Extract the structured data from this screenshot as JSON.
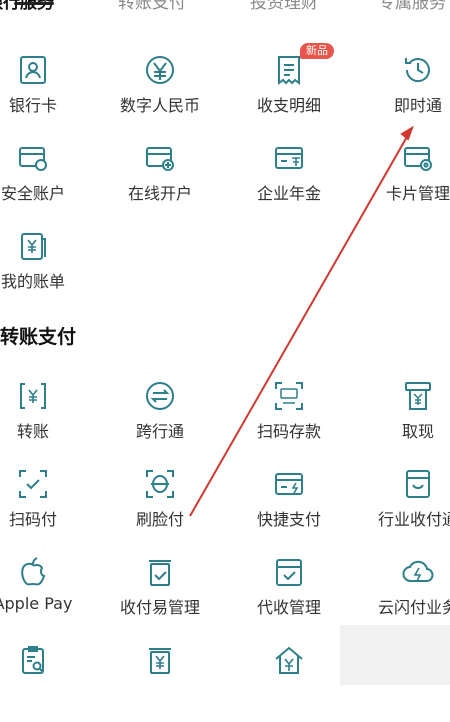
{
  "tabs": [
    {
      "label": "银行服务",
      "active": true
    },
    {
      "label": "转账支付",
      "active": false
    },
    {
      "label": "投资理财",
      "active": false
    },
    {
      "label": "专属服务",
      "active": false
    }
  ],
  "new_badge": "新品",
  "section_title": "转账支付",
  "items": [
    {
      "label": "银行卡",
      "icon": "id-card-icon"
    },
    {
      "label": "数字人民币",
      "icon": "yuan-circle-icon"
    },
    {
      "label": "收支明细",
      "icon": "receipt-icon"
    },
    {
      "label": "即时通",
      "icon": "clock-refresh-icon"
    },
    {
      "label": "安全账户",
      "icon": "card-shield-icon"
    },
    {
      "label": "在线开户",
      "icon": "card-add-icon"
    },
    {
      "label": "企业年金",
      "icon": "card-year-icon"
    },
    {
      "label": "卡片管理",
      "icon": "card-gear-icon"
    },
    {
      "label": "我的账单",
      "icon": "bill-icon"
    },
    {
      "label": "转账",
      "icon": "transfer-yuan-icon"
    },
    {
      "label": "跨行通",
      "icon": "exchange-circle-icon"
    },
    {
      "label": "扫码存款",
      "icon": "atm-scan-icon"
    },
    {
      "label": "取现",
      "icon": "atm-withdraw-icon"
    },
    {
      "label": "扫码付",
      "icon": "scan-check-icon"
    },
    {
      "label": "刷脸付",
      "icon": "face-scan-icon"
    },
    {
      "label": "快捷支付",
      "icon": "card-lightning-icon"
    },
    {
      "label": "行业收付通",
      "icon": "smile-box-icon"
    },
    {
      "label": "Apple Pay",
      "icon": "apple-icon"
    },
    {
      "label": "收付易管理",
      "icon": "clipboard-check-icon"
    },
    {
      "label": "代收管理",
      "icon": "box-check-icon"
    },
    {
      "label": "云闪付业务",
      "icon": "cloud-lightning-icon"
    },
    {
      "label": "",
      "icon": "clipboard-search-icon"
    },
    {
      "label": "",
      "icon": "yuan-document-icon"
    },
    {
      "label": "",
      "icon": "house-yuan-icon"
    }
  ],
  "colors": {
    "icon": "#2d7f8b",
    "annotation": "#d0392f",
    "badge": "#e8554b"
  }
}
